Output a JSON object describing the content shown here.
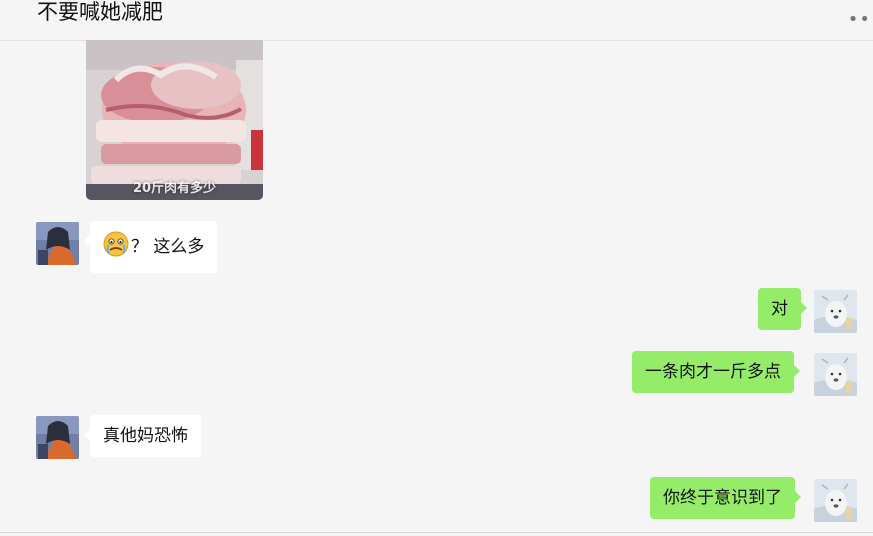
{
  "chat": {
    "title": "不要喊她减肥",
    "more_icon": "more-dots-icon"
  },
  "colors": {
    "self_bubble": "#95ec69",
    "other_bubble": "#ffffff",
    "background": "#f5f5f5"
  },
  "messages": [
    {
      "from": "other",
      "type": "image",
      "caption": "20斤肉有多少"
    },
    {
      "from": "other",
      "type": "text",
      "emoji": "tearful-face-emoji",
      "text": "？ 这么多"
    },
    {
      "from": "self",
      "type": "text",
      "text": "对"
    },
    {
      "from": "self",
      "type": "text",
      "text": "一条肉才一斤多点"
    },
    {
      "from": "other",
      "type": "text",
      "text": "真他妈恐怖"
    },
    {
      "from": "self",
      "type": "text",
      "text": "你终于意识到了"
    }
  ]
}
